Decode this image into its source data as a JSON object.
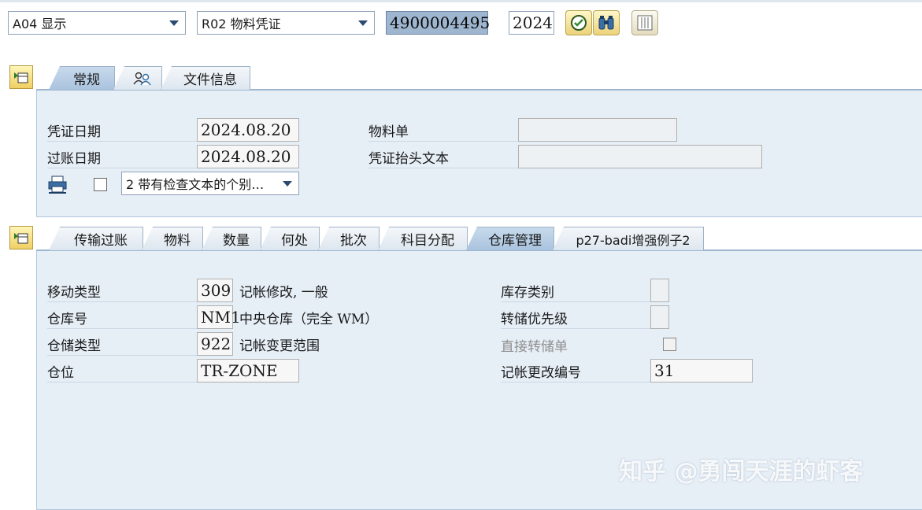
{
  "toolbar": {
    "action_select": "A04 显示",
    "reference_select": "R02 物料凭证",
    "document_number": "4900004495",
    "year": "2024"
  },
  "header": {
    "tabs": [
      {
        "label": "常规",
        "active": true
      },
      {
        "label": "",
        "icon": "partners-icon"
      },
      {
        "label": "文件信息"
      }
    ],
    "doc_date_label": "凭证日期",
    "doc_date": "2024.08.20",
    "posting_date_label": "过账日期",
    "posting_date": "2024.08.20",
    "material_slip_label": "物料单",
    "material_slip": "",
    "header_text_label": "凭证抬头文本",
    "header_text": "",
    "print_option": "2 带有检查文本的个别…"
  },
  "detail": {
    "tabs": [
      {
        "label": "传输过账"
      },
      {
        "label": "物料"
      },
      {
        "label": "数量"
      },
      {
        "label": "何处"
      },
      {
        "label": "批次"
      },
      {
        "label": "科目分配"
      },
      {
        "label": "仓库管理",
        "active": true
      },
      {
        "label": "p27-badi增强例子2"
      }
    ],
    "movement_type_label": "移动类型",
    "movement_type": "309",
    "movement_type_desc": "记帐修改, 一般",
    "warehouse_label": "仓库号",
    "warehouse": "NM1",
    "warehouse_desc": "中央仓库（完全 WM）",
    "storage_type_label": "仓储类型",
    "storage_type": "922",
    "storage_type_desc": "记帐变更范围",
    "bin_label": "仓位",
    "bin": "TR-ZONE",
    "stock_category_label": "库存类别",
    "stock_category": "",
    "transfer_priority_label": "转储优先级",
    "transfer_priority": "",
    "direct_to_label": "直接转储单",
    "posting_change_no_label": "记帐更改编号",
    "posting_change_no": "31"
  },
  "watermark": "知乎 @勇闯天涯的虾客",
  "colors": {
    "panel": "#e6eef6",
    "active_tab": "#a9c3de",
    "docnum_bg": "#9eb6cf"
  }
}
